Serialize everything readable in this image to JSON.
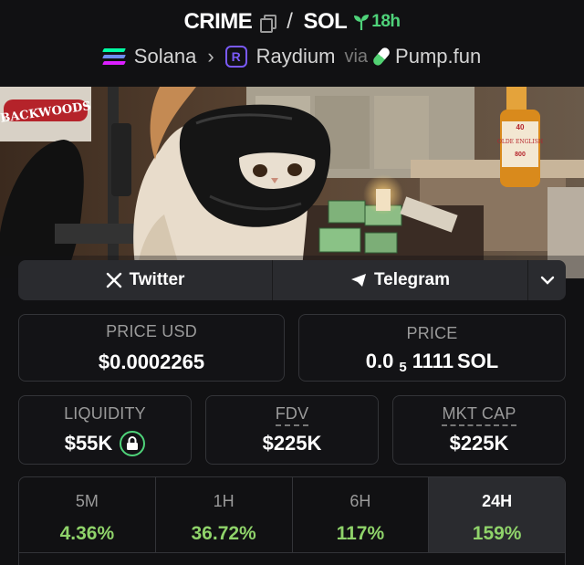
{
  "header": {
    "token_symbol": "CRIME",
    "separator": "/",
    "quote_symbol": "SOL",
    "age": "18h"
  },
  "chain_row": {
    "chain": "Solana",
    "dex": "Raydium",
    "via": "via",
    "launchpad": "Pump.fun"
  },
  "banner": {
    "sign_text": "BACKWOODS",
    "bottle_label_top": "40",
    "bottle_label_brand": "OLDE ENGLISH",
    "bottle_label_num": "800"
  },
  "social": {
    "twitter_label": "Twitter",
    "telegram_label": "Telegram"
  },
  "prices": {
    "price_usd_label": "PRICE USD",
    "price_usd_value": "$0.0002265",
    "price_label": "PRICE",
    "price_prefix": "0.0",
    "price_sub": "5",
    "price_digits": "1111",
    "price_unit": "SOL"
  },
  "metrics": {
    "liquidity_label": "LIQUIDITY",
    "liquidity_value": "$55K",
    "fdv_label": "FDV",
    "fdv_value": "$225K",
    "mktcap_label": "MKT CAP",
    "mktcap_value": "$225K"
  },
  "changes": [
    {
      "period": "5M",
      "value": "4.36%"
    },
    {
      "period": "1H",
      "value": "36.72%"
    },
    {
      "period": "6H",
      "value": "117%"
    },
    {
      "period": "24H",
      "value": "159%"
    }
  ],
  "colors": {
    "positive": "#8fd36a",
    "age_green": "#4fd37a",
    "raydium_purple": "#7a5af8",
    "card_bg": "#2a2b2f"
  }
}
